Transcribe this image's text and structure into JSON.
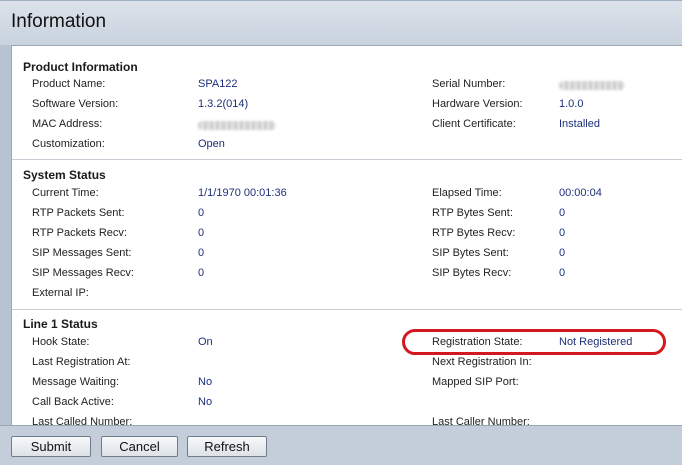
{
  "page": {
    "title": "Information"
  },
  "product_information": {
    "heading": "Product Information",
    "rows": [
      {
        "l1": "Product Name:",
        "v1": "SPA122",
        "l2": "Serial Number:",
        "v2": ""
      },
      {
        "l1": "Software Version:",
        "v1": "1.3.2(014)",
        "l2": "Hardware Version:",
        "v2": "1.0.0"
      },
      {
        "l1": "MAC Address:",
        "v1": "",
        "l2": "Client Certificate:",
        "v2": "Installed"
      },
      {
        "l1": "Customization:",
        "v1": "Open",
        "l2": "",
        "v2": ""
      }
    ]
  },
  "system_status": {
    "heading": "System Status",
    "rows": [
      {
        "l1": "Current Time:",
        "v1": "1/1/1970 00:01:36",
        "l2": "Elapsed Time:",
        "v2": "00:00:04"
      },
      {
        "l1": "RTP Packets Sent:",
        "v1": "0",
        "l2": "RTP Bytes Sent:",
        "v2": "0"
      },
      {
        "l1": "RTP Packets Recv:",
        "v1": "0",
        "l2": "RTP Bytes Recv:",
        "v2": "0"
      },
      {
        "l1": "SIP Messages Sent:",
        "v1": "0",
        "l2": "SIP Bytes Sent:",
        "v2": "0"
      },
      {
        "l1": "SIP Messages Recv:",
        "v1": "0",
        "l2": "SIP Bytes Recv:",
        "v2": "0"
      },
      {
        "l1": "External IP:",
        "v1": "",
        "l2": "",
        "v2": ""
      }
    ]
  },
  "line1_status": {
    "heading": "Line 1 Status",
    "rows": [
      {
        "l1": "Hook State:",
        "v1": "On",
        "l2": "Registration State:",
        "v2": "Not Registered"
      },
      {
        "l1": "Last Registration At:",
        "v1": "",
        "l2": "Next Registration In:",
        "v2": ""
      },
      {
        "l1": "Message Waiting:",
        "v1": "No",
        "l2": "Mapped SIP Port:",
        "v2": ""
      },
      {
        "l1": "Call Back Active:",
        "v1": "No",
        "l2": "",
        "v2": ""
      },
      {
        "l1": "Last Called Number:",
        "v1": "",
        "l2": "Last Caller Number:",
        "v2": ""
      }
    ]
  },
  "buttons": {
    "submit": "Submit",
    "cancel": "Cancel",
    "refresh": "Refresh"
  },
  "colors": {
    "highlight": "#d4181f",
    "value_text": "#1d2f7a"
  }
}
